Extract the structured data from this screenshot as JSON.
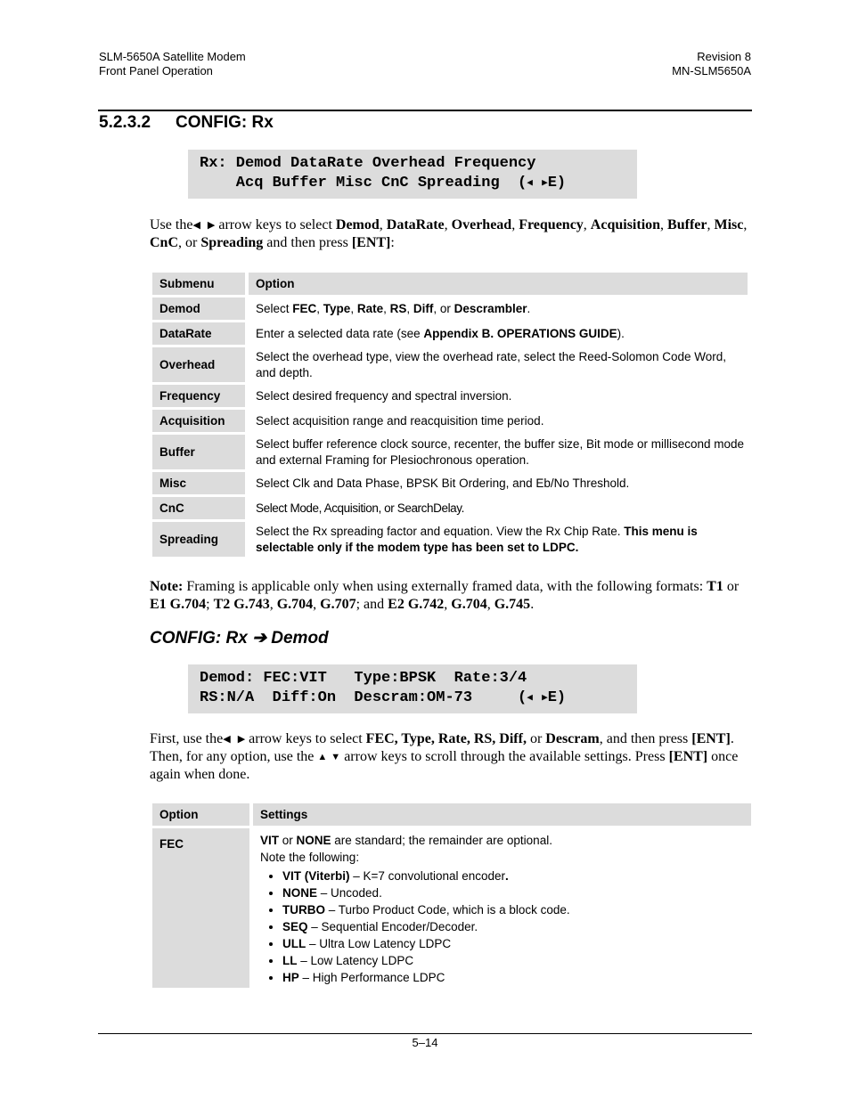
{
  "header": {
    "left_line1": "SLM-5650A Satellite Modem",
    "left_line2": "Front Panel Operation",
    "right_line1": "Revision 8",
    "right_line2": "MN-SLM5650A"
  },
  "section": {
    "number": "5.2.3.2",
    "title": "CONFIG: Rx"
  },
  "lcd_rx": {
    "line1": "Rx: Demod DataRate Overhead Frequency",
    "line2": "    Acq Buffer Misc CnC Spreading  (",
    "line2_icons": [
      "left-arrow-icon",
      "right-arrow-icon"
    ],
    "line2_end": "E)"
  },
  "intro": {
    "pre": "Use the",
    "post_arrows": " arrow keys to select ",
    "items": [
      "Demod",
      "DataRate",
      "Overhead",
      "Frequency",
      "Acquisition",
      "Buffer",
      "Misc",
      "CnC",
      "Spreading"
    ],
    "sep": ", ",
    "or": ", or ",
    "tail": " and then press ",
    "key": "[ENT]",
    "colon": ":"
  },
  "submenu_table": {
    "headers": [
      "Submenu",
      "Option"
    ],
    "rows": [
      {
        "submenu": "Demod",
        "option_parts": [
          [
            "Select ",
            ""
          ],
          [
            "FEC",
            "b"
          ],
          [
            ", ",
            ""
          ],
          [
            "Type",
            "b"
          ],
          [
            ", ",
            ""
          ],
          [
            "Rate",
            "b"
          ],
          [
            ", ",
            ""
          ],
          [
            "RS",
            "b"
          ],
          [
            ", ",
            ""
          ],
          [
            "Diff",
            "b"
          ],
          [
            ", or ",
            ""
          ],
          [
            "Descrambler",
            "b"
          ],
          [
            ".",
            ""
          ]
        ]
      },
      {
        "submenu": "DataRate",
        "option_parts": [
          [
            "Enter a selected data rate (see ",
            ""
          ],
          [
            "Appendix B. OPERATIONS GUIDE",
            "b"
          ],
          [
            ").",
            ""
          ]
        ]
      },
      {
        "submenu": "Overhead",
        "option_parts": [
          [
            "Select the overhead type, view the overhead rate, select the Reed-Solomon Code Word, and depth.",
            ""
          ]
        ]
      },
      {
        "submenu": "Frequency",
        "option_parts": [
          [
            "Select desired frequency and spectral inversion.",
            ""
          ]
        ]
      },
      {
        "submenu": "Acquisition",
        "option_parts": [
          [
            "Select acquisition range and reacquisition time period.",
            ""
          ]
        ]
      },
      {
        "submenu": "Buffer",
        "option_parts": [
          [
            "Select buffer reference clock source, recenter, the buffer size, Bit mode or millisecond mode and external Framing for Plesiochronous operation.",
            ""
          ]
        ]
      },
      {
        "submenu": "Misc",
        "option_parts": [
          [
            "Select Clk and Data Phase, BPSK Bit Ordering, and Eb/No Threshold.",
            ""
          ]
        ]
      },
      {
        "submenu": "CnC",
        "option_parts": [
          [
            "Select Mode, Acquisition, or SearchDelay.",
            ""
          ]
        ]
      },
      {
        "submenu": "Spreading",
        "option_parts": [
          [
            "Select the Rx spreading factor and equation.  View the Rx Chip Rate. ",
            ""
          ],
          [
            "This menu is selectable only if the modem type has been set to LDPC.",
            "b"
          ]
        ]
      }
    ]
  },
  "note": {
    "label": "Note:",
    "text": " Framing is applicable only when using externally framed data, with the following formats: ",
    "parts": [
      [
        "T1",
        "b"
      ],
      [
        " or ",
        ""
      ],
      [
        "E1 G.704",
        "b"
      ],
      [
        "; ",
        ""
      ],
      [
        "T2 G.743",
        "b"
      ],
      [
        ", ",
        ""
      ],
      [
        "G.704",
        "b"
      ],
      [
        ", ",
        ""
      ],
      [
        "G.707",
        "b"
      ],
      [
        "; and ",
        ""
      ],
      [
        "E2 G.742",
        "b"
      ],
      [
        ", ",
        ""
      ],
      [
        "G.704",
        "b"
      ],
      [
        ", ",
        ""
      ],
      [
        "G.745",
        "b"
      ],
      [
        ".",
        ""
      ]
    ]
  },
  "subsection": {
    "prefix": "CONFIG: Rx ",
    "arrow": "➔",
    "suffix": " Demod"
  },
  "lcd_demod": {
    "line1": "Demod: FEC:VIT   Type:BPSK  Rate:3/4",
    "line2": "RS:N/A  Diff:On  Descram:OM-73     (",
    "line2_end": "E)"
  },
  "demod_intro": {
    "pre": "First, use the",
    "mid1": " arrow keys to select ",
    "items_bold": "FEC, Type, Rate, RS, Diff,",
    "or": " or ",
    "last": "Descram",
    "mid2": ", and then press ",
    "key1": "[ENT]",
    "mid3": ". Then, for any option, use the ",
    "mid4": " arrow keys to scroll through the available settings. Press ",
    "key2": "[ENT]",
    "tail": " once again when done."
  },
  "settings_table": {
    "headers": [
      "Option",
      "Settings"
    ],
    "rows": [
      {
        "option": "FEC",
        "line1_parts": [
          [
            "VIT",
            "b"
          ],
          [
            " or ",
            ""
          ],
          [
            "NONE",
            "b"
          ],
          [
            " are standard; the remainder are optional.",
            ""
          ]
        ],
        "line2": "Note the following:",
        "bullets": [
          {
            "term": "VIT (Viterbi)",
            "desc": " – K=7 convolutional encoder",
            "end": "."
          },
          {
            "term": "NONE",
            "desc": " – Uncoded.",
            "end": ""
          },
          {
            "term": "TURBO",
            "desc": " – Turbo Product Code, which is a block code.",
            "end": ""
          },
          {
            "term": "SEQ",
            "desc": " – Sequential Encoder/Decoder.",
            "end": ""
          },
          {
            "term": "ULL",
            "desc": " – Ultra Low Latency LDPC",
            "end": ""
          },
          {
            "term": "LL",
            "desc": " – Low Latency LDPC",
            "end": ""
          },
          {
            "term": "HP",
            "desc": " – High Performance LDPC",
            "end": ""
          }
        ]
      }
    ]
  },
  "footer": {
    "page": "5–14"
  },
  "icons": {
    "left": "◀",
    "right": "▶",
    "up": "▲",
    "down": "▼"
  }
}
